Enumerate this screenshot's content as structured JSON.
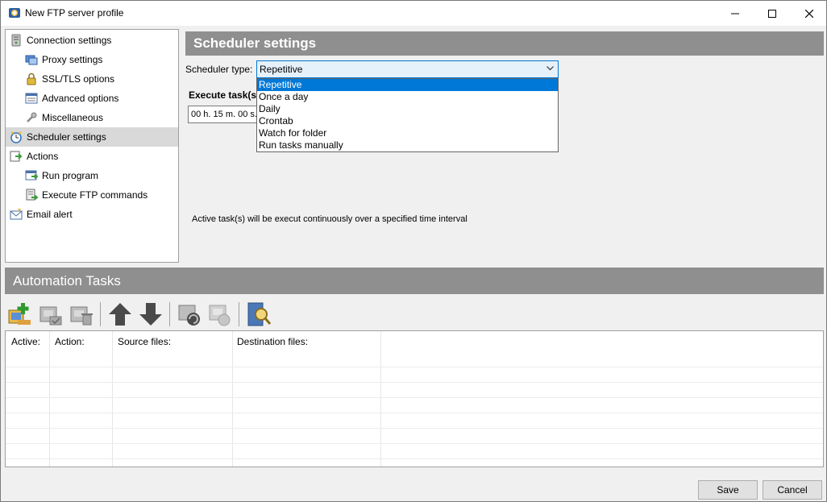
{
  "window": {
    "title": "New FTP server profile"
  },
  "tree": {
    "items": [
      {
        "label": "Connection settings",
        "icon": "server-icon",
        "level": 0
      },
      {
        "label": "Proxy settings",
        "icon": "proxy-icon",
        "level": 1
      },
      {
        "label": "SSL/TLS options",
        "icon": "lock-icon",
        "level": 1
      },
      {
        "label": "Advanced options",
        "icon": "settings-list-icon",
        "level": 1
      },
      {
        "label": "Miscellaneous",
        "icon": "tools-icon",
        "level": 1
      },
      {
        "label": "Scheduler settings",
        "icon": "clock-icon",
        "level": 0,
        "selected": true
      },
      {
        "label": "Actions",
        "icon": "actions-icon",
        "level": 0
      },
      {
        "label": "Run program",
        "icon": "run-program-icon",
        "level": 1
      },
      {
        "label": "Execute FTP commands",
        "icon": "ftp-commands-icon",
        "level": 1
      },
      {
        "label": "Email alert",
        "icon": "email-icon",
        "level": 0
      }
    ]
  },
  "scheduler": {
    "header": "Scheduler settings",
    "type_label": "Scheduler type:",
    "type_value": "Repetitive",
    "execute_label": "Execute task(s)",
    "duration_value": "00 h. 15 m. 00 s.",
    "description": "Active task(s) will be execut continuously over a specified time interval",
    "options": [
      "Repetitive",
      "Once a day",
      "Daily",
      "Crontab",
      "Watch for folder",
      "Run tasks manually"
    ]
  },
  "automation": {
    "header": "Automation Tasks",
    "toolbar": [
      "add-task-icon",
      "edit-task-icon",
      "delete-task-icon",
      "move-up-icon",
      "move-down-icon",
      "refresh-task-icon",
      "disabled-task-icon",
      "preview-search-icon"
    ],
    "columns": [
      "Active:",
      "Action:",
      "Source files:",
      "Destination files:"
    ]
  },
  "footer": {
    "save_label": "Save",
    "cancel_label": "Cancel"
  },
  "colors": {
    "accent": "#0078d7",
    "header_bg": "#8f8f8f",
    "selection_bg": "#d9d9d9"
  }
}
